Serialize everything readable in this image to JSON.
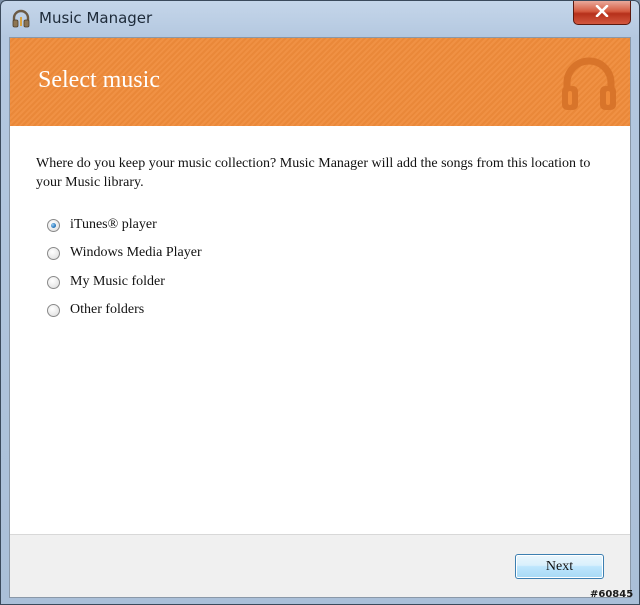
{
  "window": {
    "title": "Music Manager"
  },
  "banner": {
    "title": "Select music",
    "color": "#ef8b3a"
  },
  "prompt": "Where do you keep your music collection? Music Manager will add the songs from this location to your Music library.",
  "options": [
    {
      "label": "iTunes® player",
      "selected": true
    },
    {
      "label": "Windows Media Player",
      "selected": false
    },
    {
      "label": "My Music folder",
      "selected": false
    },
    {
      "label": "Other folders",
      "selected": false
    }
  ],
  "footer": {
    "next_label": "Next"
  },
  "icons": {
    "app": "headphones-icon",
    "banner": "headphones-icon",
    "close": "close-icon"
  },
  "watermark": "#60845"
}
